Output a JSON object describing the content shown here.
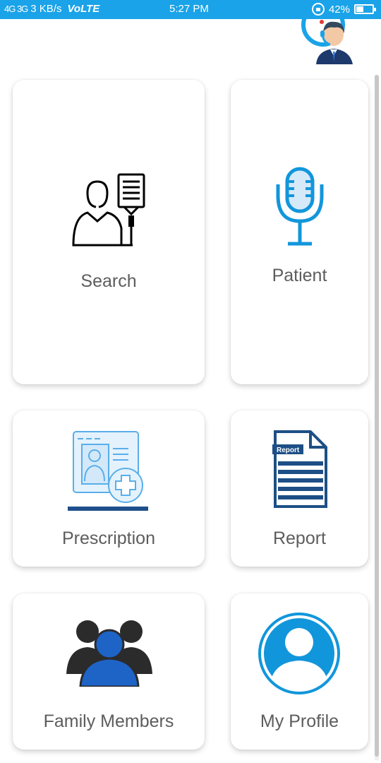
{
  "status_bar": {
    "network": "4G 3G",
    "speed": "3 KB/s",
    "volte": "VoLTE",
    "time": "5:27 PM",
    "battery": "42%",
    "battery_level": 0.42
  },
  "cards": {
    "search": {
      "label": "Search",
      "icon": "doctor-iv-icon"
    },
    "patient": {
      "label": "Patient",
      "icon": "microphone-icon"
    },
    "prescription": {
      "label": "Prescription",
      "icon": "prescription-icon"
    },
    "report": {
      "label": "Report",
      "icon": "report-icon",
      "badge": "Report"
    },
    "family": {
      "label": "Family Members",
      "icon": "family-icon"
    },
    "profile": {
      "label": "My Profile",
      "icon": "profile-icon"
    }
  },
  "colors": {
    "status_bar": "#1aa3e8",
    "accent_blue": "#1296db",
    "report_navy": "#1d4f86",
    "label_gray": "#5d5d5d"
  }
}
